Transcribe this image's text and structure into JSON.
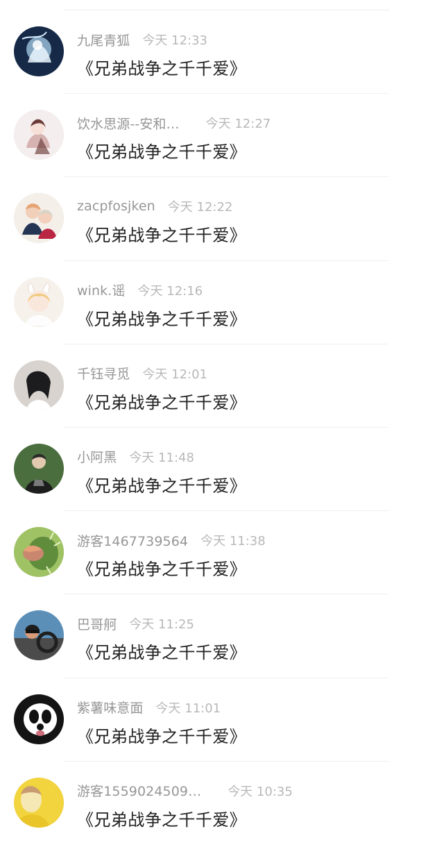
{
  "comments": [
    {
      "username": "九尾青狐",
      "time": "今天 12:33",
      "text": "《兄弟战争之千千爱》",
      "avatar": "fox-spirit-art-avatar",
      "colors": [
        "#162a48",
        "#9fc4de",
        "#eaf4fb"
      ]
    },
    {
      "username": "饮水思源--安和…",
      "time": "今天 12:27",
      "text": "《兄弟战争之千千爱》",
      "avatar": "anime-girl-sketch-avatar",
      "colors": [
        "#f5eeee",
        "#6a3b37",
        "#d6b2b1"
      ]
    },
    {
      "username": "zacpfosjken",
      "time": "今天 12:22",
      "text": "《兄弟战争之千千爱》",
      "avatar": "anime-boys-avatar",
      "colors": [
        "#f4efe8",
        "#243654",
        "#e5a474"
      ]
    },
    {
      "username": "wink.谣",
      "time": "今天 12:16",
      "text": "《兄弟战争之千千爱》",
      "avatar": "bunny-ear-girl-avatar",
      "colors": [
        "#f6f1eb",
        "#f1c97a",
        "#fdfdfd"
      ]
    },
    {
      "username": "千钰寻觅",
      "time": "今天 12:01",
      "text": "《兄弟战争之千千爱》",
      "avatar": "dark-hair-girl-photo-avatar",
      "colors": [
        "#d8d3ce",
        "#1c1c1e",
        "#f1ebe4"
      ]
    },
    {
      "username": "小阿黑",
      "time": "今天 11:48",
      "text": "《兄弟战争之千千爱》",
      "avatar": "boy-in-black-shirt-avatar",
      "colors": [
        "#4b6e3f",
        "#1d1d1d",
        "#e2c9b0"
      ]
    },
    {
      "username": "游客1467739564",
      "time": "今天 11:38",
      "text": "《兄弟战争之千千爱》",
      "avatar": "cactus-flower-avatar",
      "colors": [
        "#5f8d3c",
        "#c98770",
        "#9fc264"
      ]
    },
    {
      "username": "巴哥舸",
      "time": "今天 11:25",
      "text": "《兄弟战争之千千爱》",
      "avatar": "driver-in-car-avatar",
      "colors": [
        "#5b8fb8",
        "#4b4b4b",
        "#d89a78"
      ]
    },
    {
      "username": "紫薯味意面",
      "time": "今天 11:01",
      "text": "《兄弟战争之千千爱》",
      "avatar": "panda-ok-avatar",
      "colors": [
        "#141414",
        "#ffffff",
        "#cf6d7a"
      ]
    },
    {
      "username": "游客1559024509…",
      "time": "今天 10:35",
      "text": "《兄弟战争之千千爱》",
      "avatar": "yellow-toned-photo-avatar",
      "colors": [
        "#f2d43f",
        "#f6e8b4",
        "#c99b70"
      ]
    }
  ]
}
